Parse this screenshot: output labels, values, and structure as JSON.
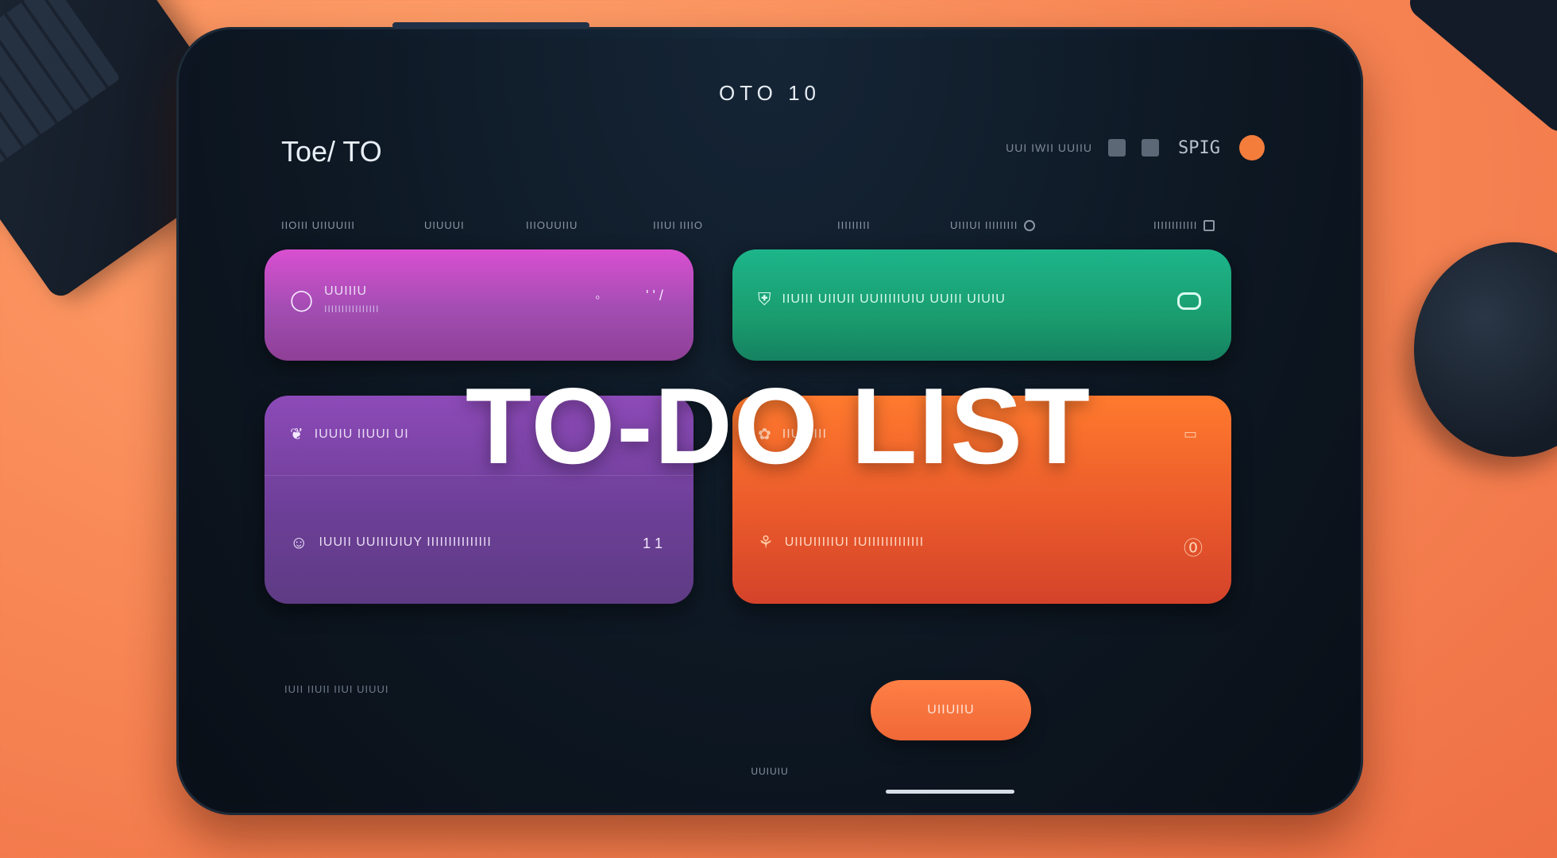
{
  "screen": {
    "title": "OTO 10"
  },
  "app": {
    "title": "Toe/ TO"
  },
  "toolbar": {
    "label": "UUI IWII UUIIU",
    "code": "SPIG"
  },
  "nav": {
    "items": [
      "IIOIII UIIUUIII",
      "UIUUUI",
      "IIIOUUIIU",
      "IIIUI IIIIO",
      "IIIIIIIII",
      "UIIIUI IIIIIIIII",
      "IIIIIIIIIIII"
    ]
  },
  "cards": {
    "pink": {
      "title": "UUIIIU",
      "subtitle": "IIIIIIIIIIIIIIII",
      "trailing": "' ' /"
    },
    "green": {
      "title": "IIUIII UIIUII UUIIIIIUIU UUIII UIUIU"
    },
    "purple": {
      "row1": "IUUIU IIUUI UI",
      "row2": "IUUII UUIIIUIUY IIIIIIIIIIIIIII",
      "trailing": "1 1"
    },
    "orange": {
      "row1": "IIU IIIII",
      "row2": "UIIUIIIIIUI IUIIIIIIIIIIIII"
    }
  },
  "overlay": {
    "title": "TO-DO LIST"
  },
  "footer": {
    "left_text": "IUII IIUII IIUI UIUUI",
    "button_label": "UIIUIIU",
    "caption": "UUIUIU"
  },
  "colors": {
    "background": "#f98a57",
    "tablet": "#0d1825",
    "pink": "#c04cc6",
    "green": "#1aa377",
    "purple": "#7b45aa",
    "orange": "#f56a2c",
    "accent": "#f47d3b"
  }
}
